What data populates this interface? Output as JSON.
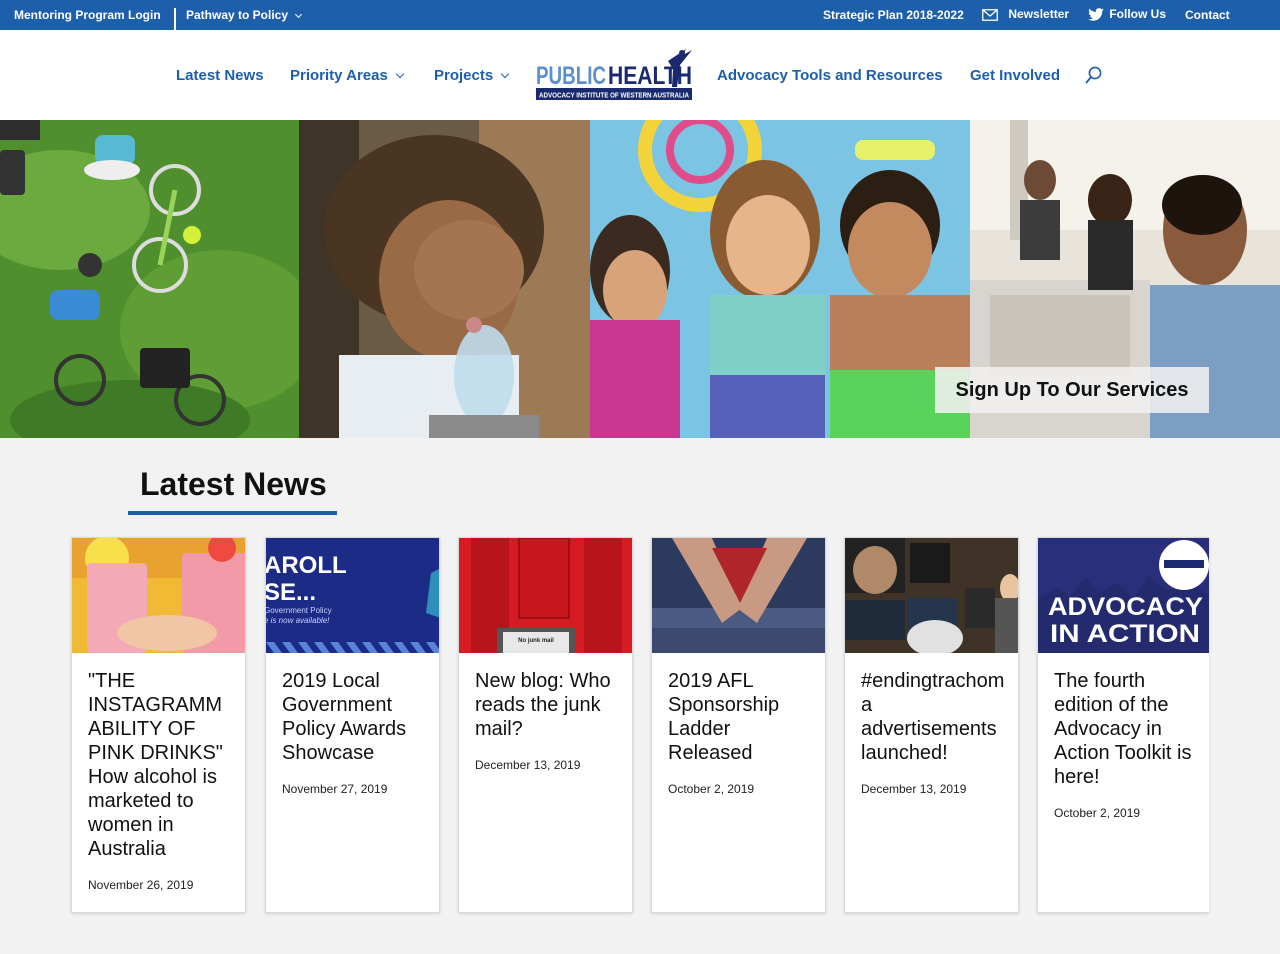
{
  "topbar": {
    "mentoring": "Mentoring Program Login",
    "pathway": "Pathway to Policy",
    "strategic": "Strategic Plan 2018-2022",
    "newsletter": "Newsletter",
    "follow": "Follow Us",
    "contact": "Contact"
  },
  "nav": {
    "latest_news": "Latest News",
    "priority_areas": "Priority Areas",
    "projects": "Projects",
    "advocacy_tools": "Advocacy Tools and Resources",
    "get_involved": "Get Involved"
  },
  "logo": {
    "line1a": "PUBLIC",
    "line1b": "HEALTH",
    "line2": "ADVOCACY INSTITUTE OF WESTERN AUSTRALIA"
  },
  "hero": {
    "signup": "Sign Up To Our Services"
  },
  "news": {
    "section_title": "Latest News",
    "items": [
      {
        "title": "\"THE INSTAGRAMMABILITY OF PINK DRINKS\" How alcohol is marketed to women in Australia",
        "date": "November 26, 2019"
      },
      {
        "title": "2019 Local Government Policy Awards Showcase",
        "date": "November 27, 2019",
        "thumb_text1": "AROLL",
        "thumb_text2": "SE...",
        "thumb_text3": "Government Policy",
        "thumb_text4": "e is now available!"
      },
      {
        "title": "New blog: Who reads the junk mail?",
        "date": "December 13, 2019",
        "thumb_text1": "No junk mail"
      },
      {
        "title": "2019 AFL Sponsorship Ladder Released",
        "date": "October 2, 2019"
      },
      {
        "title": "#endingtrachoma advertisements launched!",
        "date": "December 13, 2019"
      },
      {
        "title": "The fourth edition of the Advocacy in Action Toolkit is here!",
        "date": "October 2, 2019",
        "thumb_text1": "ADVOCACY",
        "thumb_text2": "IN ACTION"
      }
    ]
  },
  "colors": {
    "brand_blue": "#1d5fab",
    "navy": "#1b2a6e"
  }
}
